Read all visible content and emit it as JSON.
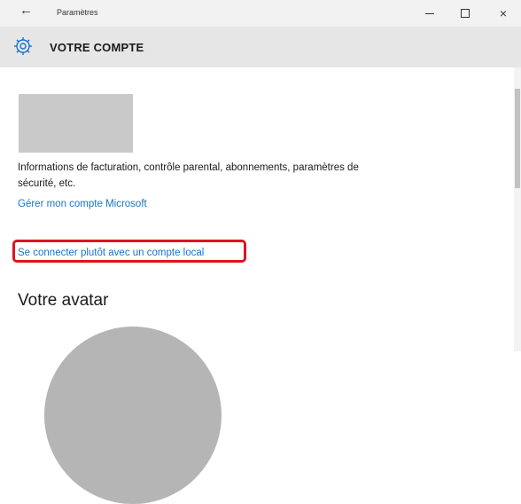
{
  "window": {
    "title": "Paramètres",
    "back_icon": "←",
    "close_icon": "×"
  },
  "header": {
    "icon": "gear-icon",
    "title": "VOTRE COMPTE",
    "accent_color": "#1a73c9"
  },
  "account": {
    "info": "Informations de facturation, contrôle parental, abonnements, paramètres de sécurité, etc.",
    "manage_link": "Gérer mon compte Microsoft",
    "local_account_link": "Se connecter plutôt avec un compte local",
    "highlight_color": "#e0141e"
  },
  "avatar": {
    "heading": "Votre avatar"
  }
}
